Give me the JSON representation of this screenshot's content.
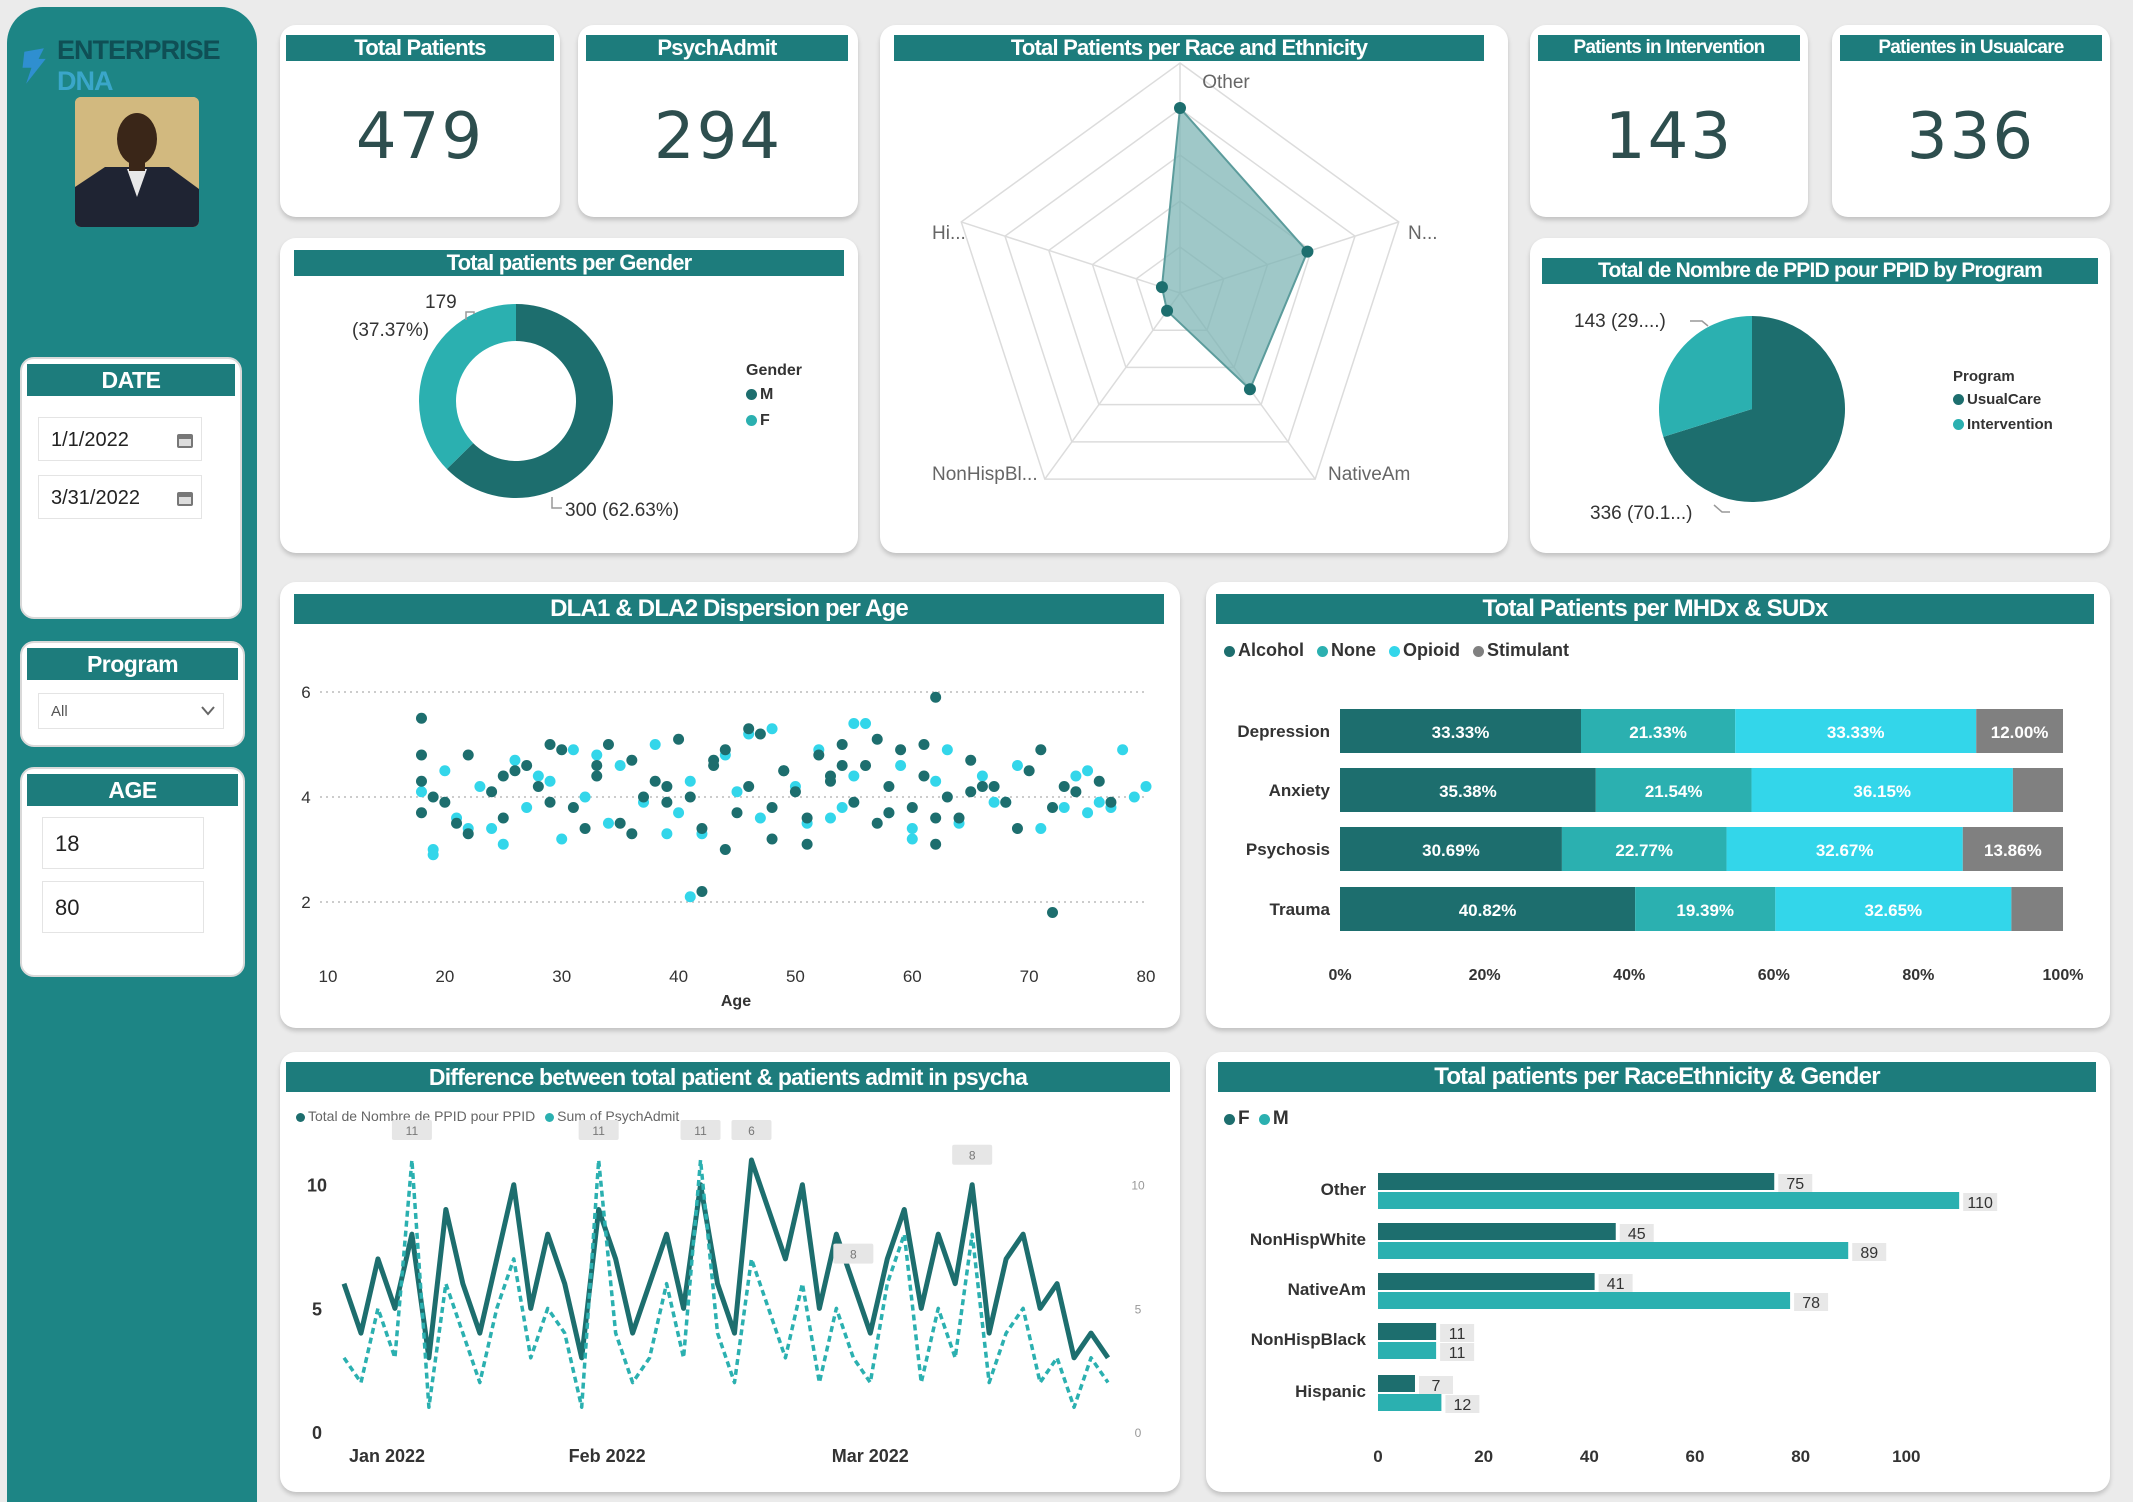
{
  "brand": {
    "logo_part1": "ENTERPRISE",
    "logo_part2": "DNA"
  },
  "colors": {
    "teal_dark": "#1d6e6e",
    "teal_mid": "#2bb0b0",
    "cyan": "#33d6ea",
    "gray": "#808080",
    "sidebar": "#1d8585",
    "header": "#1d7c7c"
  },
  "slicers": {
    "date": {
      "title": "DATE",
      "start": "1/1/2022",
      "end": "3/31/2022"
    },
    "program": {
      "title": "Program",
      "value": "All"
    },
    "age": {
      "title": "AGE",
      "min": "18",
      "max": "80"
    }
  },
  "kpis": {
    "total_patients": {
      "title": "Total Patients",
      "value": "479"
    },
    "psych_admit": {
      "title": "PsychAdmit",
      "value": "294"
    },
    "intervention": {
      "title": "Patients in Intervention",
      "value": "143"
    },
    "usualcare": {
      "title": "Patientes in Usualcare",
      "value": "336"
    }
  },
  "gender_chart": {
    "title": "Total patients per Gender",
    "legend_title": "Gender",
    "legend": [
      "M",
      "F"
    ],
    "label_f_count": "179",
    "label_f_pct": "(37.37%)",
    "label_m": "300 (62.63%)"
  },
  "radar": {
    "title": "Total Patients per Race and Ethnicity",
    "axis_labels": [
      "Other",
      "N...",
      "NativeAm",
      "NonHispBl...",
      "Hi..."
    ]
  },
  "program_pie": {
    "title": "Total de Nombre de PPID pour PPID by Program",
    "legend_title": "Program",
    "legend": [
      "UsualCare",
      "Intervention"
    ],
    "label_intervention": "143 (29....)",
    "label_usualcare": "336 (70.1...)"
  },
  "scatter": {
    "title": "DLA1 & DLA2 Dispersion per Age",
    "xlabel": "Age",
    "x_ticks": [
      "10",
      "20",
      "30",
      "40",
      "50",
      "60",
      "70",
      "80"
    ],
    "y_ticks": [
      "6",
      "4",
      "2"
    ]
  },
  "mhdx": {
    "title": "Total Patients per MHDx & SUDx",
    "legend": [
      "Alcohol",
      "None",
      "Opioid",
      "Stimulant"
    ],
    "x_ticks": [
      "0%",
      "20%",
      "40%",
      "60%",
      "80%",
      "100%"
    ]
  },
  "line": {
    "title": "Difference between total patient & patients admit in psycha",
    "legend": [
      "Total de Nombre de PPID pour PPID",
      "Sum of PsychAdmit"
    ],
    "y_ticks": [
      "10",
      "5",
      "0"
    ],
    "x_ticks": [
      "Jan 2022",
      "Feb 2022",
      "Mar 2022"
    ],
    "right_ticks": [
      "10",
      "5",
      "0"
    ],
    "peak_labels": [
      "11",
      "11",
      "11",
      "6",
      "8",
      "8"
    ]
  },
  "race_gender": {
    "title": "Total patients per RaceEthnicity & Gender",
    "legend": [
      "F",
      "M"
    ],
    "x_ticks": [
      "0",
      "20",
      "40",
      "60",
      "80",
      "100"
    ]
  },
  "chart_data": [
    {
      "type": "pie",
      "title": "Total patients per Gender",
      "categories": [
        "M",
        "F"
      ],
      "values": [
        300,
        179
      ]
    },
    {
      "type": "radar",
      "title": "Total Patients per Race and Ethnicity",
      "categories": [
        "Other",
        "NonHispWhite",
        "NativeAm",
        "NonHispBlack",
        "Hispanic"
      ],
      "values": [
        185,
        134,
        119,
        22,
        19
      ],
      "max": 230
    },
    {
      "type": "pie",
      "title": "Total de Nombre de PPID pour PPID by Program",
      "categories": [
        "UsualCare",
        "Intervention"
      ],
      "values": [
        336,
        143
      ]
    },
    {
      "type": "scatter",
      "title": "DLA1 & DLA2 Dispersion per Age",
      "xlabel": "Age",
      "xlim": [
        10,
        80
      ],
      "ylim": [
        1.5,
        6.5
      ],
      "series": [
        {
          "name": "DLA1",
          "x": [
            18,
            18,
            18,
            19,
            20,
            22,
            24,
            25,
            27,
            28,
            30,
            31,
            33,
            34,
            35,
            36,
            38,
            39,
            40,
            41,
            42,
            43,
            44,
            45,
            46,
            47,
            48,
            49,
            50,
            51,
            52,
            53,
            54,
            55,
            56,
            57,
            58,
            59,
            60,
            61,
            62,
            63,
            64,
            65,
            66,
            68,
            70,
            72,
            74,
            76,
            22,
            26,
            29,
            32,
            37,
            43,
            48,
            53,
            57,
            62,
            67,
            71,
            18,
            21,
            25,
            29,
            33,
            36,
            39,
            44,
            46,
            49,
            51,
            54,
            58,
            61,
            65,
            69,
            73,
            77,
            62,
            72,
            42
          ],
          "y": [
            5.5,
            4.3,
            3.7,
            4.0,
            3.9,
            4.8,
            4.1,
            3.6,
            4.6,
            4.2,
            4.9,
            3.8,
            4.4,
            5.0,
            3.5,
            4.7,
            4.3,
            3.9,
            5.1,
            4.0,
            3.4,
            4.6,
            4.9,
            3.7,
            4.2,
            5.2,
            3.8,
            4.5,
            4.1,
            3.6,
            4.8,
            4.3,
            5.0,
            3.9,
            4.6,
            3.5,
            4.2,
            4.9,
            3.8,
            4.4,
            5.9,
            4.0,
            3.6,
            4.7,
            4.2,
            3.9,
            4.5,
            3.8,
            4.1,
            4.3,
            3.3,
            4.5,
            5.0,
            3.4,
            4.0,
            4.7,
            3.2,
            4.4,
            5.1,
            3.6,
            4.2,
            4.9,
            4.8,
            3.5,
            4.4,
            3.9,
            4.6,
            3.3,
            4.2,
            3.0,
            5.3,
            4.5,
            3.1,
            4.6,
            3.7,
            5.0,
            4.1,
            3.4,
            4.2,
            3.9,
            3.1,
            1.8,
            2.2
          ]
        },
        {
          "name": "DLA2",
          "x": [
            18,
            19,
            20,
            21,
            23,
            24,
            26,
            27,
            28,
            30,
            31,
            32,
            34,
            35,
            37,
            38,
            40,
            41,
            42,
            44,
            45,
            47,
            48,
            50,
            51,
            52,
            54,
            55,
            56,
            58,
            59,
            60,
            62,
            63,
            64,
            66,
            67,
            69,
            71,
            73,
            75,
            76,
            77,
            79,
            80,
            19,
            25,
            33,
            39,
            46,
            53,
            60,
            68,
            74,
            55,
            41,
            29,
            22,
            78,
            75
          ],
          "y": [
            4.1,
            3.0,
            4.5,
            3.6,
            4.2,
            3.4,
            4.7,
            3.8,
            4.4,
            3.2,
            4.9,
            4.0,
            3.5,
            4.6,
            3.9,
            5.0,
            3.7,
            4.3,
            3.3,
            4.8,
            4.1,
            3.6,
            5.3,
            4.2,
            3.5,
            4.9,
            3.8,
            4.4,
            5.4,
            3.7,
            4.6,
            3.2,
            4.3,
            4.9,
            3.5,
            4.4,
            3.9,
            4.6,
            3.4,
            3.8,
            4.5,
            3.9,
            3.8,
            4.0,
            4.2,
            2.9,
            3.1,
            4.8,
            3.3,
            5.2,
            3.6,
            3.4,
            3.9,
            4.4,
            5.4,
            2.1,
            4.3,
            3.4,
            4.9,
            3.7
          ]
        }
      ]
    },
    {
      "type": "bar",
      "title": "Total Patients per MHDx & SUDx",
      "stacked": "100%",
      "categories": [
        "Depression",
        "Anxiety",
        "Psychosis",
        "Trauma"
      ],
      "series": [
        {
          "name": "Alcohol",
          "values": [
            33.33,
            35.38,
            30.69,
            40.82
          ]
        },
        {
          "name": "None",
          "values": [
            21.33,
            21.54,
            22.77,
            19.39
          ]
        },
        {
          "name": "Opioid",
          "values": [
            33.33,
            36.15,
            32.67,
            32.65
          ]
        },
        {
          "name": "Stimulant",
          "values": [
            12.0,
            6.93,
            13.86,
            7.14
          ]
        }
      ],
      "data_labels": [
        [
          "33.33%",
          "21.33%",
          "33.33%",
          "12.00%"
        ],
        [
          "35.38%",
          "21.54%",
          "36.15%",
          ""
        ],
        [
          "30.69%",
          "22.77%",
          "32.67%",
          "13.86%"
        ],
        [
          "40.82%",
          "19.39%",
          "32.65%",
          ""
        ]
      ]
    },
    {
      "type": "line",
      "title": "Difference between total patient & patients admit in psycha",
      "ylim": [
        0,
        11
      ],
      "x": [
        "Jan 1",
        "Jan 3",
        "Jan 5",
        "Jan 7",
        "Jan 9",
        "Jan 11",
        "Jan 13",
        "Jan 15",
        "Jan 17",
        "Jan 19",
        "Jan 21",
        "Jan 23",
        "Jan 25",
        "Jan 27",
        "Jan 29",
        "Jan 31",
        "Feb 2",
        "Feb 4",
        "Feb 6",
        "Feb 8",
        "Feb 10",
        "Feb 12",
        "Feb 14",
        "Feb 16",
        "Feb 18",
        "Feb 20",
        "Feb 22",
        "Feb 24",
        "Feb 26",
        "Feb 28",
        "Mar 2",
        "Mar 4",
        "Mar 6",
        "Mar 8",
        "Mar 10",
        "Mar 12",
        "Mar 14",
        "Mar 16",
        "Mar 18",
        "Mar 20",
        "Mar 22",
        "Mar 24",
        "Mar 26",
        "Mar 28",
        "Mar 30",
        "Mar 31"
      ],
      "series": [
        {
          "name": "Total de Nombre de PPID pour PPID",
          "values": [
            6,
            4,
            7,
            5,
            8,
            3,
            9,
            6,
            4,
            7,
            10,
            5,
            8,
            6,
            3,
            9,
            7,
            4,
            6,
            8,
            5,
            10,
            6,
            4,
            11,
            9,
            7,
            10,
            5,
            8,
            6,
            4,
            7,
            9,
            5,
            8,
            6,
            10,
            4,
            7,
            8,
            5,
            6,
            3,
            4,
            3
          ]
        },
        {
          "name": "Sum of PsychAdmit",
          "values": [
            3,
            2,
            5,
            3,
            11,
            1,
            6,
            4,
            2,
            5,
            7,
            3,
            5,
            4,
            1,
            11,
            4,
            2,
            3,
            6,
            3,
            11,
            4,
            2,
            7,
            5,
            3,
            6,
            2,
            5,
            3,
            2,
            6,
            8,
            2,
            5,
            3,
            8,
            2,
            4,
            5,
            2,
            3,
            1,
            3,
            2
          ]
        }
      ]
    },
    {
      "type": "bar",
      "orientation": "horizontal",
      "title": "Total patients per RaceEthnicity & Gender",
      "categories": [
        "Other",
        "NonHispWhite",
        "NativeAm",
        "NonHispBlack",
        "Hispanic"
      ],
      "xlim": [
        0,
        120
      ],
      "series": [
        {
          "name": "F",
          "values": [
            75,
            45,
            41,
            11,
            7
          ]
        },
        {
          "name": "M",
          "values": [
            110,
            89,
            78,
            11,
            12
          ]
        }
      ]
    }
  ]
}
